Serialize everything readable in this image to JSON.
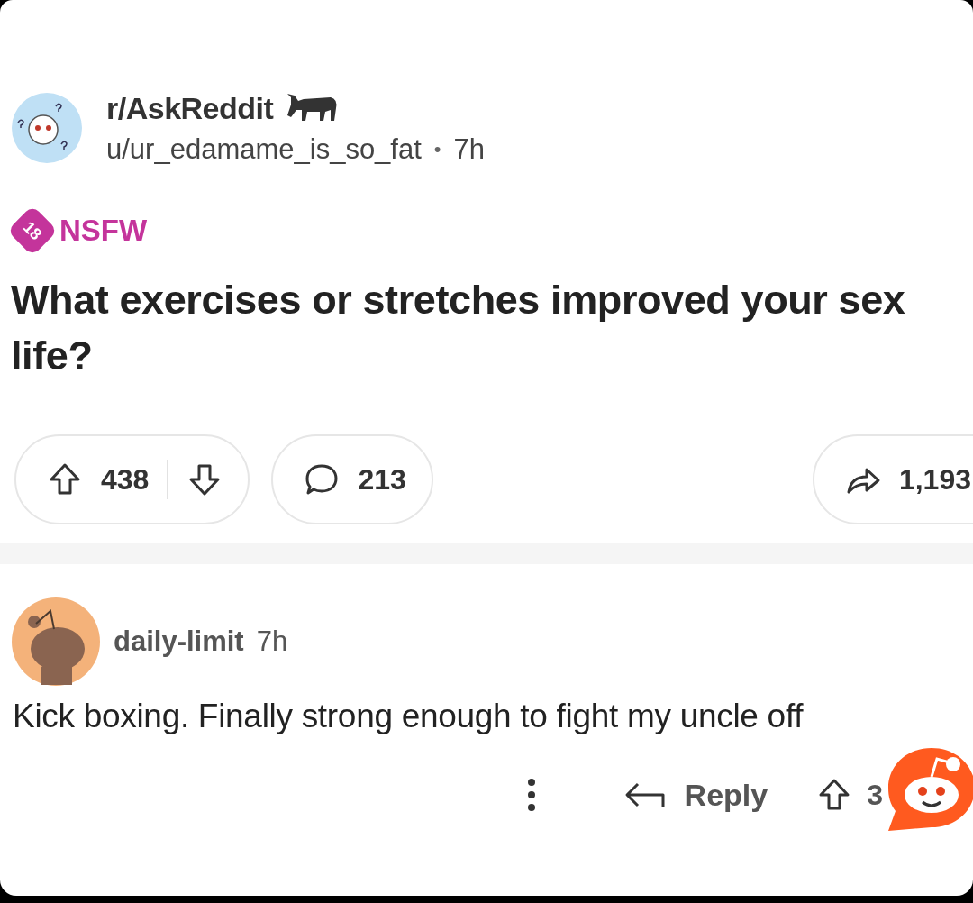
{
  "post": {
    "subreddit": "r/AskReddit",
    "author": "u/ur_edamame_is_so_fat",
    "separator": "•",
    "age": "7h",
    "nsfw": {
      "badge": "18",
      "label": "NSFW"
    },
    "title": "What exercises or stretches improved your sex life?",
    "votes": "438",
    "comments": "213",
    "shares": "1,193"
  },
  "comment": {
    "author": "daily-limit",
    "age": "7h",
    "text": "Kick boxing. Finally strong enough to fight my uncle off",
    "reply": "Reply",
    "votes": "3"
  }
}
